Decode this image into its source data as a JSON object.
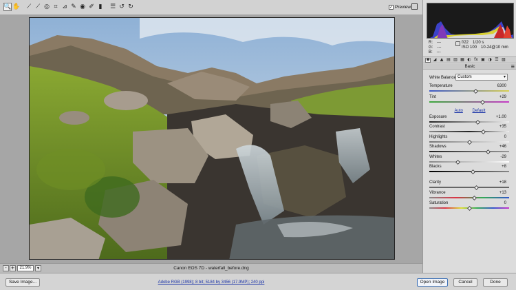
{
  "toolbar": {
    "tools": [
      {
        "name": "zoom-tool",
        "glyph": "🔍",
        "active": true
      },
      {
        "name": "hand-tool",
        "glyph": "✋"
      },
      {
        "name": "white-balance-tool",
        "glyph": "⟋"
      },
      {
        "name": "color-sampler-tool",
        "glyph": "⟋"
      },
      {
        "name": "targeted-adjustment-tool",
        "glyph": "◎"
      },
      {
        "name": "crop-tool",
        "glyph": "⌗"
      },
      {
        "name": "straighten-tool",
        "glyph": "⊿"
      },
      {
        "name": "spot-removal-tool",
        "glyph": "✎"
      },
      {
        "name": "red-eye-tool",
        "glyph": "◉"
      },
      {
        "name": "adjustment-brush-tool",
        "glyph": "✐"
      },
      {
        "name": "graduated-filter-tool",
        "glyph": "▮"
      },
      {
        "name": "preferences-tool",
        "glyph": "☰"
      },
      {
        "name": "rotate-ccw-tool",
        "glyph": "↺"
      },
      {
        "name": "rotate-cw-tool",
        "glyph": "↻"
      }
    ],
    "preview_label": "Preview",
    "preview_checked": "✓"
  },
  "status": {
    "zoom_out": "-",
    "zoom_in": "+",
    "zoom_value": "21.9%",
    "zoom_dropdown": "▾",
    "filename": "Canon EOS 7D  -  waterfall_before.dng"
  },
  "bottom": {
    "save_image": "Save Image...",
    "workflow": "Adobe RGB (1998); 8 bit; 5184 by 3456 (17.9MP); 240 ppi",
    "open_image": "Open Image",
    "cancel": "Cancel",
    "done": "Done"
  },
  "readout": {
    "r_label": "R:",
    "r_value": "---",
    "g_label": "G:",
    "g_value": "---",
    "b_label": "B:",
    "b_value": "---",
    "aperture": "f/22",
    "shutter": "1/20 s",
    "iso": "ISO 100",
    "lens": "10-24@10 mm"
  },
  "panel": {
    "tabs": [
      "◉",
      "◢",
      "▲",
      "▤",
      "▥",
      "▦",
      "◐",
      "fx",
      "▣",
      "◑",
      "☰",
      "▧"
    ],
    "section_title": "Basic",
    "menu_icon": "☰",
    "white_balance_label": "White Balance:",
    "white_balance_value": "Custom",
    "white_balance_arrow": "▾",
    "auto": "Auto",
    "default": "Default"
  },
  "sliders": {
    "temperature": {
      "label": "Temperature",
      "value": "6300",
      "pos": 0.58
    },
    "tint": {
      "label": "Tint",
      "value": "+29",
      "pos": 0.66
    },
    "exposure": {
      "label": "Exposure",
      "value": "+1.00",
      "pos": 0.6
    },
    "contrast": {
      "label": "Contrast",
      "value": "+35",
      "pos": 0.67
    },
    "highlights": {
      "label": "Highlights",
      "value": "0",
      "pos": 0.5
    },
    "shadows": {
      "label": "Shadows",
      "value": "+46",
      "pos": 0.73
    },
    "whites": {
      "label": "Whites",
      "value": "-29",
      "pos": 0.35
    },
    "blacks": {
      "label": "Blacks",
      "value": "+8",
      "pos": 0.54
    },
    "clarity": {
      "label": "Clarity",
      "value": "+18",
      "pos": 0.59
    },
    "vibrance": {
      "label": "Vibrance",
      "value": "+13",
      "pos": 0.56
    },
    "saturation": {
      "label": "Saturation",
      "value": "0",
      "pos": 0.5
    }
  },
  "colors": {
    "accent": "#3b6fb5",
    "link": "#1a33a8"
  }
}
